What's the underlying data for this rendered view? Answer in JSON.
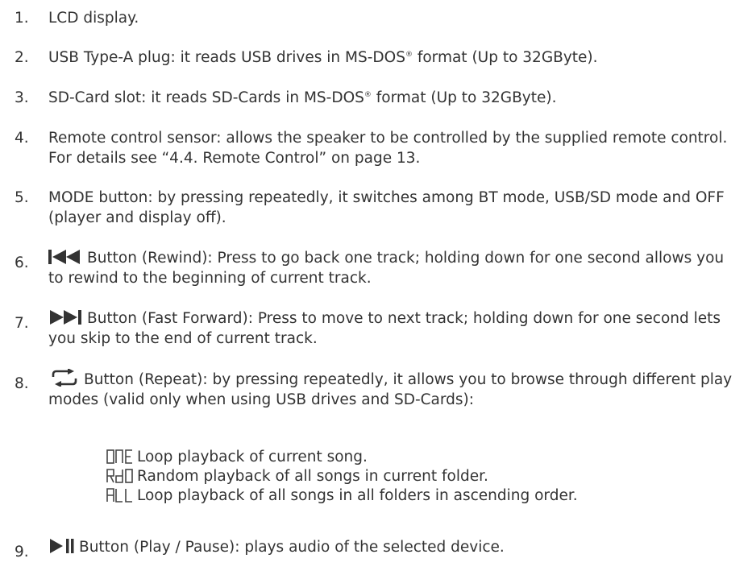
{
  "items": [
    {
      "num": "1.",
      "text": "LCD display."
    },
    {
      "num": "2.",
      "text_before": "USB Type-A plug: it reads USB drives in MS-DOS",
      "reg": "®",
      "text_after": " format (Up to 32GByte)."
    },
    {
      "num": "3.",
      "text_before": "SD-Card slot: it reads SD-Cards in MS-DOS",
      "reg": "®",
      "text_after": " format (Up to 32GByte)."
    },
    {
      "num": "4.",
      "text": "Remote control sensor: allows the speaker to be controlled by the supplied remote control. For details see “4.4. Remote Control” on page 13."
    },
    {
      "num": "5.",
      "text": "MODE button: by pressing repeatedly, it switches among BT mode, USB/SD mode and OFF (player and display off)."
    },
    {
      "num": "6.",
      "icon": "rewind-icon",
      "text": "Button (Rewind): Press to go back one track; holding down for one second allows you to rewind to the beginning of current track."
    },
    {
      "num": "7.",
      "icon": "fast-forward-icon",
      "text": "Button (Fast Forward): Press to move to next track; holding down for one second lets you skip to the end of current track."
    },
    {
      "num": "8.",
      "icon": "repeat-icon",
      "text": "Button (Repeat): by pressing repeatedly, it allows you to browse through different play modes (valid only when using USB drives and SD-Cards):"
    },
    {
      "num": "9.",
      "icon": "play-pause-icon",
      "text": "Button (Play / Pause): plays audio of the selected device."
    }
  ],
  "play_modes": [
    {
      "display": "ONE",
      "text": "Loop playback of current song."
    },
    {
      "display": "RdO",
      "text": "Random playback of all songs in current folder."
    },
    {
      "display": "ALL",
      "text": "Loop playback of all songs in all folders in ascending order."
    }
  ]
}
